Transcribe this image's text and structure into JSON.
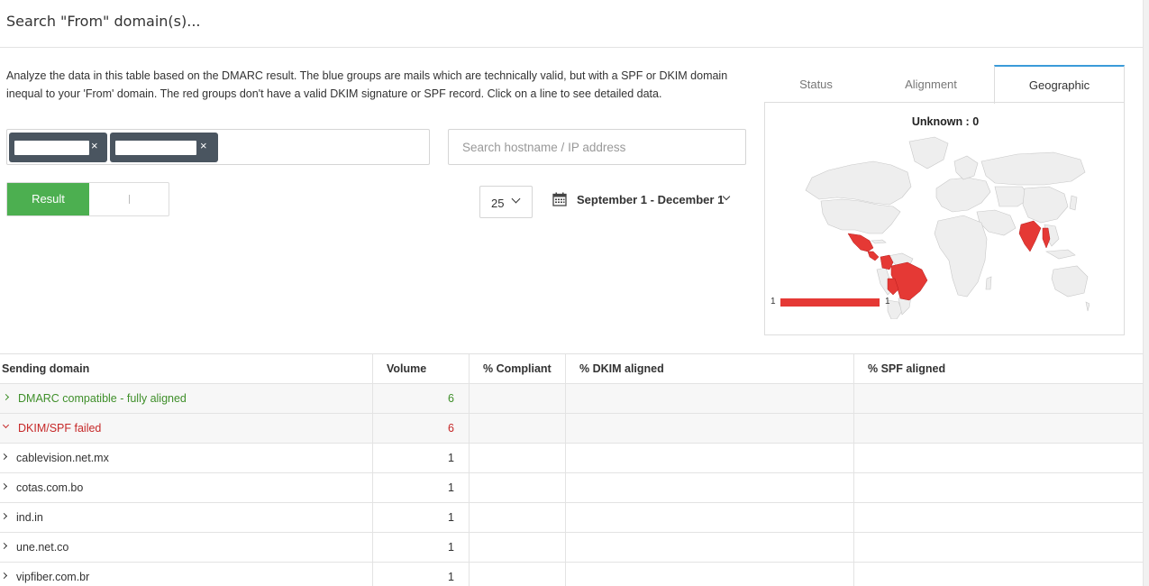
{
  "topbar": {
    "search_title": "Search \"From\" domain(s)..."
  },
  "description": "Analyze the data in this table based on the DMARC result. The blue groups are mails which are technically valid, but with a SPF or DKIM domain inequal to your 'From' domain. The red groups don't have a valid DKIM signature or SPF record. Click on a line to see detailed data.",
  "filters": {
    "tag_remove": "×",
    "host_placeholder": "Search hostname / IP address",
    "toggle_label": "Result",
    "page_size": "25",
    "date_range": "September 1 - December 1"
  },
  "tabs": [
    "Status",
    "Alignment",
    "Geographic"
  ],
  "map": {
    "unknown_label": "Unknown : 0",
    "legend_min": "1",
    "legend_max": "1",
    "highlight_color": "#e53935",
    "highlighted_countries": [
      "Mexico",
      "Guatemala",
      "Colombia",
      "Bolivia",
      "Brazil",
      "India",
      "Myanmar"
    ]
  },
  "table": {
    "headers": [
      "Sending domain",
      "Volume",
      "% Compliant",
      "% DKIM aligned",
      "% SPF aligned"
    ],
    "groups": [
      {
        "label": "DMARC compatible - fully aligned",
        "volume": "6",
        "color": "#3f8f2a"
      },
      {
        "label": "DKIM/SPF failed",
        "volume": "6",
        "color": "#c62828"
      }
    ],
    "rows": [
      {
        "domain": "cablevision.net.mx",
        "volume": "1"
      },
      {
        "domain": "cotas.com.bo",
        "volume": "1"
      },
      {
        "domain": "ind.in",
        "volume": "1"
      },
      {
        "domain": "une.net.co",
        "volume": "1"
      },
      {
        "domain": "vipfiber.com.br",
        "volume": "1"
      }
    ]
  }
}
